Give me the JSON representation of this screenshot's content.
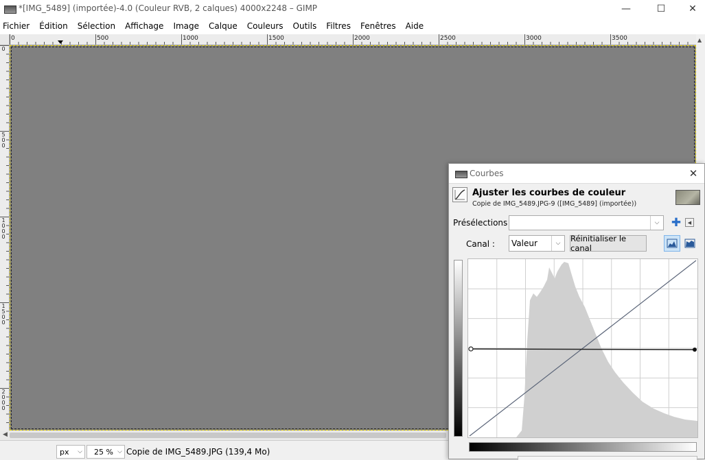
{
  "window": {
    "title": "*[IMG_5489] (importée)-4.0 (Couleur RVB, 2 calques) 4000x2248 – GIMP",
    "minimize": "—",
    "maximize": "☐",
    "close": "✕"
  },
  "menu": [
    "Fichier",
    "Édition",
    "Sélection",
    "Affichage",
    "Image",
    "Calque",
    "Couleurs",
    "Outils",
    "Filtres",
    "Fenêtres",
    "Aide"
  ],
  "rulers": {
    "h_labels": [
      "0",
      "500",
      "1000",
      "1500",
      "2000",
      "2500",
      "3000",
      "3500"
    ],
    "v_labels": [
      "0",
      "500",
      "1000",
      "1500",
      "2000"
    ]
  },
  "status": {
    "unit": "px",
    "zoom": "25 %",
    "info": "Copie de IMG_5489.JPG (139,4 Mo)"
  },
  "curves": {
    "dialog_title": "Courbes",
    "heading": "Ajuster les courbes de couleur",
    "subtitle": "Copie de IMG_5489.JPG-9 ([IMG_5489] (importée))",
    "presets_label": "Présélections :",
    "presets_value": "",
    "channel_label": "Canal :",
    "channel_value": "Valeur",
    "reset_label": "Réinitialiser le canal",
    "icons": {
      "close": "✕",
      "add": "✚",
      "menu": "◀",
      "dropdown": "⌵"
    }
  },
  "colors": {
    "canvas": "#808080",
    "selection_marching_ants": "#e6d200",
    "histogram": "#d0d0d0",
    "diagonal": "#5a6478",
    "curve": "#222222"
  }
}
